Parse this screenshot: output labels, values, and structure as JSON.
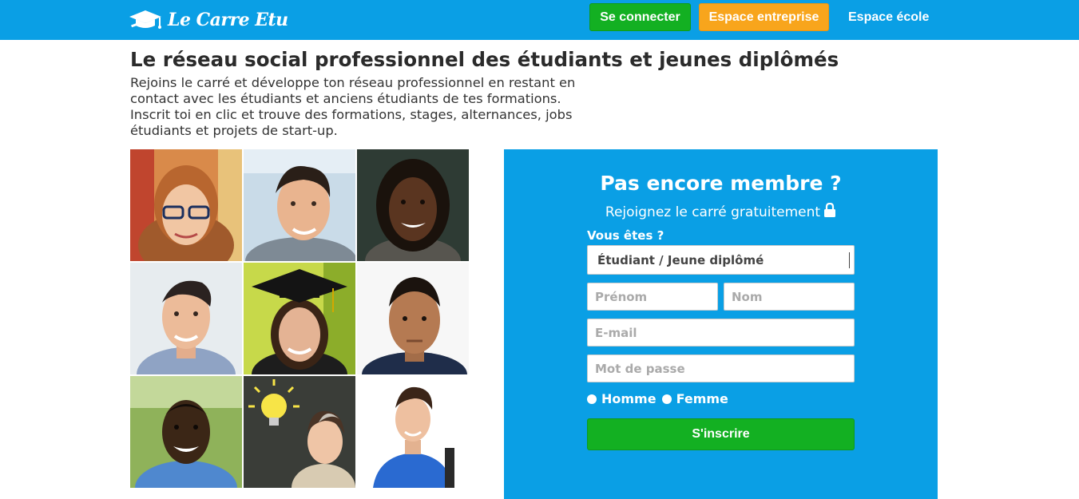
{
  "header": {
    "logo_text": "Le Carre Etu",
    "connect_label": "Se connecter",
    "entreprise_label": "Espace entreprise",
    "ecole_label": "Espace école"
  },
  "hero": {
    "title": "Le réseau social professionnel des étudiants et jeunes diplômés",
    "description": "Rejoins le carré et développe ton réseau professionnel en restant en contact avec les étudiants et anciens étudiants de tes formations. Inscrit toi en clic et trouve des formations, stages, alternances, jobs étudiants et projets de start-up."
  },
  "signup": {
    "title": "Pas encore membre ?",
    "subtitle": "Rejoignez le carré gratuitement",
    "question": "Vous êtes ?",
    "status_selected": "Étudiant / Jeune diplômé",
    "placeholders": {
      "prenom": "Prénom",
      "nom": "Nom",
      "email": "E-mail",
      "password": "Mot de passe"
    },
    "gender_options": [
      "Homme",
      "Femme"
    ],
    "submit_label": "S'inscrire"
  },
  "colors": {
    "brand_blue": "#0a9fe5",
    "green": "#13b022",
    "orange": "#f8a51c"
  },
  "icons": {
    "logo": "graduation-cap-icon",
    "lock": "lock-icon"
  }
}
